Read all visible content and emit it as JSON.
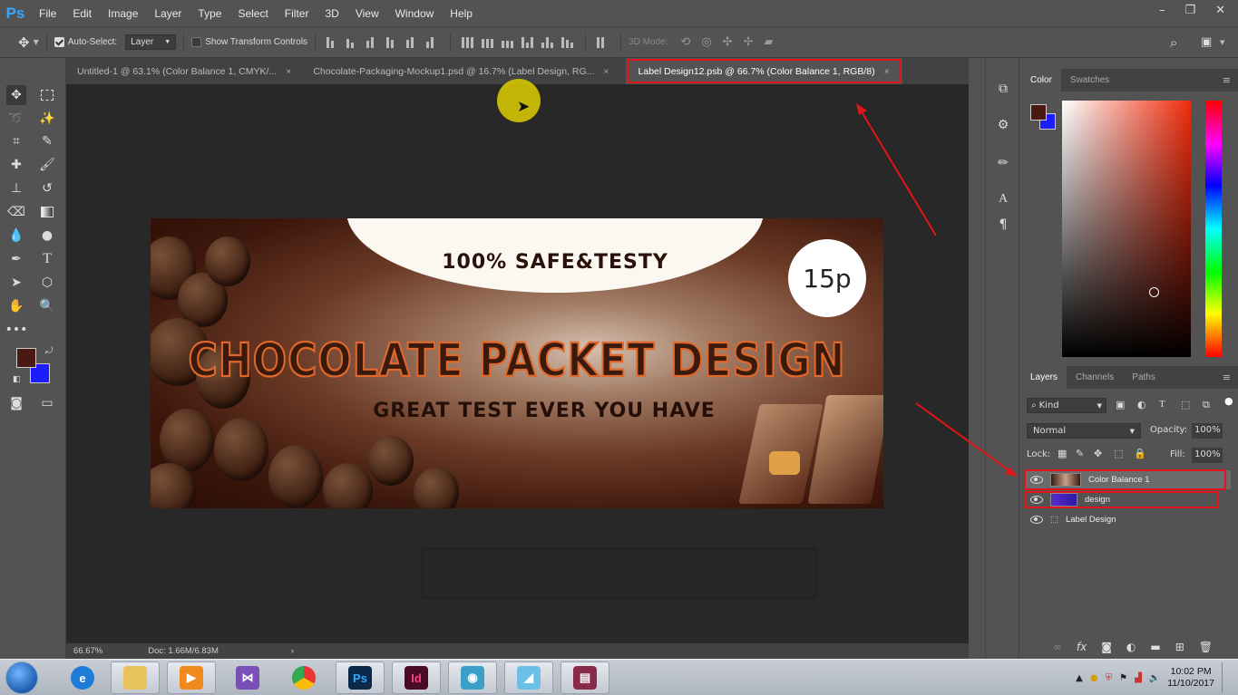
{
  "app": {
    "logo": "Ps"
  },
  "menu": [
    "File",
    "Edit",
    "Image",
    "Layer",
    "Type",
    "Select",
    "Filter",
    "3D",
    "View",
    "Window",
    "Help"
  ],
  "window_controls": {
    "minimize": "–",
    "restore": "❐",
    "close": "✕"
  },
  "options_bar": {
    "auto_select_label": "Auto-Select:",
    "auto_select_target": "Layer",
    "show_transform_label": "Show Transform Controls",
    "mode_3d_label": "3D Mode:"
  },
  "doc_tabs": [
    {
      "title": "Untitled-1 @ 63.1% (Color Balance 1, CMYK/...",
      "close": "×"
    },
    {
      "title": "Chocolate-Packaging-Mockup1.psd @ 16.7% (Label Design, RG...",
      "close": "×"
    },
    {
      "title": "Label Design12.psb @ 66.7% (Color Balance 1, RGB/8)",
      "close": "×",
      "active": true
    }
  ],
  "artwork": {
    "safe_text": "100% SAFE&TESTY",
    "badge": "15p",
    "headline": "CHOCOLATE PACKET DESIGN",
    "tagline": "GREAT TEST EVER YOU HAVE"
  },
  "status_bar": {
    "zoom": "66.67%",
    "doc": "Doc: 1.66M/6.83M",
    "arrow": "›"
  },
  "color_panel": {
    "tabs": [
      "Color",
      "Swatches"
    ],
    "foreground": "#4a1a12",
    "background": "#1c1cff"
  },
  "layers_panel": {
    "tabs": [
      "Layers",
      "Channels",
      "Paths"
    ],
    "filter_kind": "Kind",
    "blend_mode": "Normal",
    "opacity_label": "Opacity:",
    "opacity_value": "100%",
    "lock_label": "Lock:",
    "fill_label": "Fill:",
    "fill_value": "100%",
    "layers": [
      {
        "name": "Color Balance 1"
      },
      {
        "name": "design"
      },
      {
        "name": "Label Design"
      }
    ]
  },
  "taskbar": {
    "time": "10:02 PM",
    "date": "11/10/2017",
    "ps_label": "Ps",
    "id_label": "Id"
  }
}
